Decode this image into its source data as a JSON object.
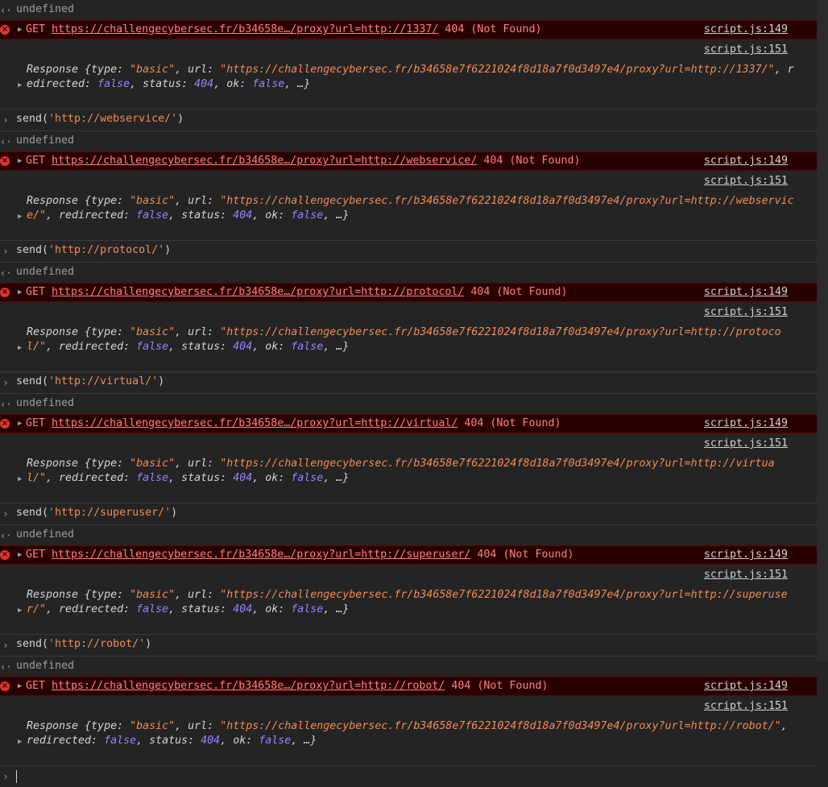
{
  "console": {
    "undefined_text": "undefined",
    "source_get": "script.js:149",
    "source_response": "script.js:151",
    "get_prefix": "GET",
    "status_code": "404",
    "status_text": "(Not Found)",
    "blocks": [
      {
        "input": null,
        "get_url": "https://challengecybersec.fr/b34658e…/proxy?url=http://1337/",
        "response_text": "Response {type: \"basic\", url: \"https://challengecybersec.fr/b34658e7f6221024f8d18a7f0d3497e4/proxy?url=http://1337/\", redirected: false, status: 404, ok: false, …}",
        "target": "http://1337/"
      },
      {
        "input": "send('http://webservice/')",
        "input_arg": "'http://webservice/'",
        "get_url": "https://challengecybersec.fr/b34658e…/proxy?url=http://webservice/",
        "target": "http://webservice/"
      },
      {
        "input": "send('http://protocol/')",
        "input_arg": "'http://protocol/'",
        "get_url": "https://challengecybersec.fr/b34658e…/proxy?url=http://protocol/",
        "target": "http://protocol/"
      },
      {
        "input": "send('http://virtual/')",
        "input_arg": "'http://virtual/'",
        "get_url": "https://challengecybersec.fr/b34658e…/proxy?url=http://virtual/",
        "target": "http://virtual/"
      },
      {
        "input": "send('http://superuser/')",
        "input_arg": "'http://superuser/'",
        "get_url": "https://challengecybersec.fr/b34658e…/proxy?url=http://superuser/",
        "target": "http://superuser/"
      },
      {
        "input": "send('http://robot/')",
        "input_arg": "'http://robot/'",
        "get_url": "https://challengecybersec.fr/b34658e…/proxy?url=http://robot/",
        "target": "http://robot/"
      }
    ],
    "response_base_url": "https://challengecybersec.fr/b34658e7f6221024f8d18a7f0d3497e4/proxy?url=",
    "response_type": "basic",
    "response_redirected": "false",
    "response_status": "404",
    "response_ok": "false"
  }
}
